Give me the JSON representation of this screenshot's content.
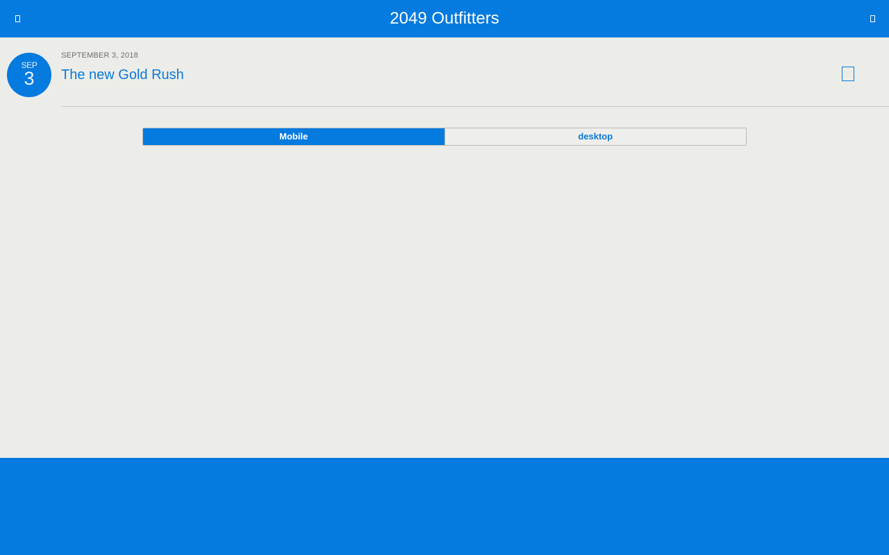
{
  "header": {
    "title": "2049 Outfitters",
    "left_icon": "menu-icon",
    "right_icon": "search-icon"
  },
  "post": {
    "badge_month": "SEP",
    "badge_day": "3",
    "date": "SEPTEMBER 3, 2018",
    "title": "The new Gold Rush",
    "action_icon": "bookmark-icon"
  },
  "view_toggle": {
    "options": [
      "Mobile",
      "desktop"
    ],
    "selected": "Mobile"
  },
  "colors": {
    "accent": "#057adf",
    "background": "#ecede8",
    "link": "#0a79da",
    "muted_text": "#6d6f6c"
  }
}
